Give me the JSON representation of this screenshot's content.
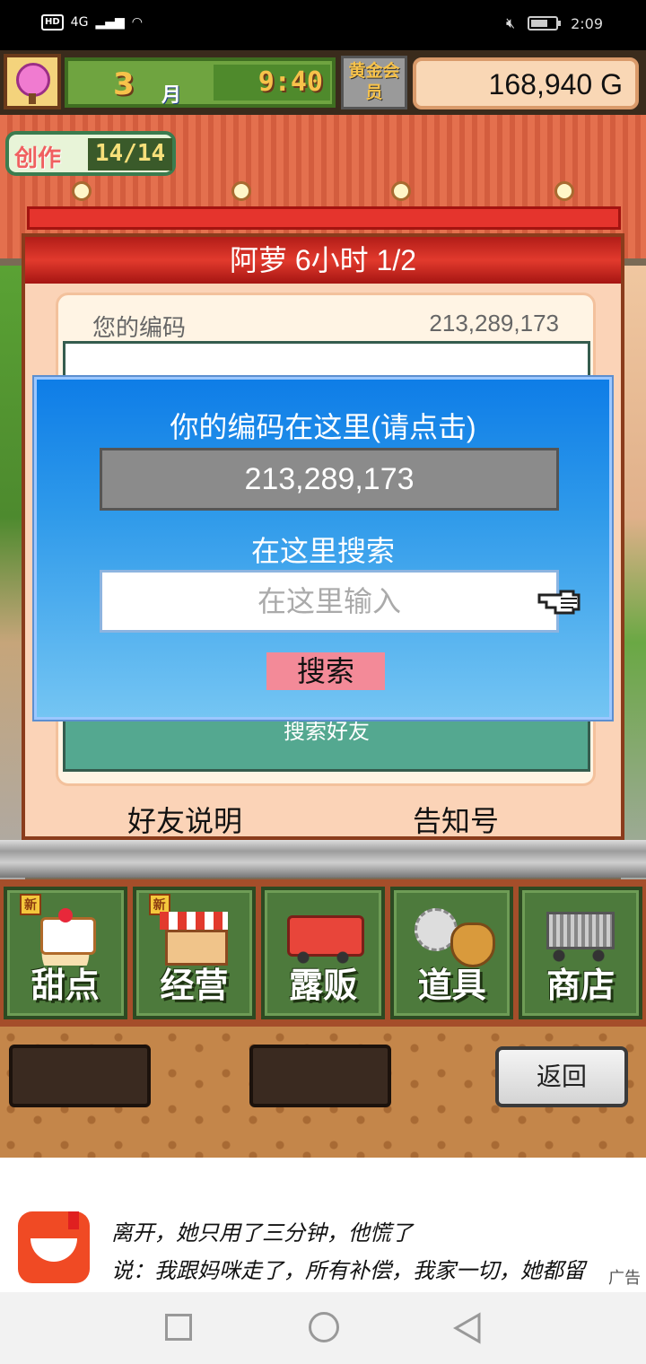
{
  "status_bar": {
    "hd": "HD",
    "network": "4G",
    "time": "2:09"
  },
  "hud": {
    "month": "3",
    "month_label": "月",
    "time": "9:40",
    "member_badge": "黄金会员",
    "money": "168,940 G"
  },
  "create_badge": {
    "label": "创作",
    "count": "14/14"
  },
  "panel": {
    "title": "阿萝  6小时 1/2",
    "code_label": "您的编码",
    "code_value": "213,289,173",
    "search_friend": "搜索好友",
    "footer_left": "好友说明",
    "footer_right": "告知号"
  },
  "modal": {
    "title": "你的编码在这里(请点击)",
    "code": "213,289,173",
    "search_title": "在这里搜索",
    "search_placeholder": "在这里输入",
    "search_button": "搜索"
  },
  "menu": {
    "items": [
      {
        "label": "甜点",
        "icon": "cake-icon",
        "new": "新"
      },
      {
        "label": "经营",
        "icon": "shop-icon",
        "new": "新"
      },
      {
        "label": "露贩",
        "icon": "food-truck-icon"
      },
      {
        "label": "道具",
        "icon": "tools-icon"
      },
      {
        "label": "商店",
        "icon": "cart-icon"
      }
    ]
  },
  "back_button": "返回",
  "ad": {
    "line1": "离开，她只用了三分钟，他慌了",
    "line2": "说：我跟妈咪走了，所有补偿，我家一切，她都留",
    "tag": "广告"
  }
}
